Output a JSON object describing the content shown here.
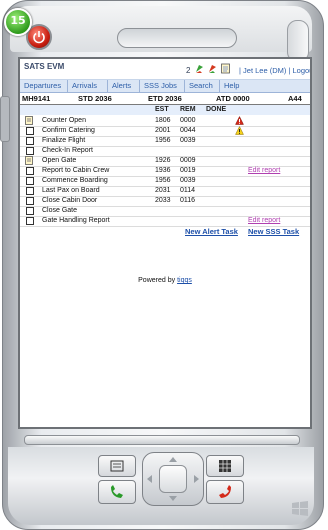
{
  "device": {
    "badge_text": "15"
  },
  "titlebar": {
    "app_title": "SATS EVM",
    "alert_count": "2",
    "user_text": "| Jet Lee (DM) | Logout"
  },
  "tabs": [
    "Departures",
    "Arrivals",
    "Alerts",
    "SSS Jobs",
    "Search",
    "Help"
  ],
  "flight": {
    "number": "MH9141",
    "std": "STD 2036",
    "etd": "ETD 2036",
    "atd": "ATD 0000",
    "gate": "A44"
  },
  "columns": {
    "est": "EST",
    "rem": "REM",
    "done": "DONE"
  },
  "tasks": [
    {
      "name": "Counter Open",
      "est": "1806",
      "rem": "0000",
      "icon": "note-icon",
      "alert": "red-alert-icon",
      "edit": ""
    },
    {
      "name": "Confirm Catering",
      "est": "2001",
      "rem": "0044",
      "icon": "checkbox",
      "alert": "yellow-warning-icon",
      "edit": ""
    },
    {
      "name": "Finalize Flight",
      "est": "1956",
      "rem": "0039",
      "icon": "checkbox",
      "alert": "",
      "edit": ""
    },
    {
      "name": "Check-In Report",
      "est": "",
      "rem": "",
      "icon": "checkbox",
      "alert": "",
      "edit": ""
    },
    {
      "name": "Open Gate",
      "est": "1926",
      "rem": "0009",
      "icon": "note-icon",
      "alert": "",
      "edit": ""
    },
    {
      "name": "Report to Cabin Crew",
      "est": "1936",
      "rem": "0019",
      "icon": "checkbox",
      "alert": "",
      "edit": "Edit report"
    },
    {
      "name": "Commence Boarding",
      "est": "1956",
      "rem": "0039",
      "icon": "checkbox",
      "alert": "",
      "edit": ""
    },
    {
      "name": "Last Pax on Board",
      "est": "2031",
      "rem": "0114",
      "icon": "checkbox",
      "alert": "",
      "edit": ""
    },
    {
      "name": "Close Cabin Door",
      "est": "2033",
      "rem": "0116",
      "icon": "checkbox",
      "alert": "",
      "edit": ""
    },
    {
      "name": "Close Gate",
      "est": "",
      "rem": "",
      "icon": "checkbox",
      "alert": "",
      "edit": ""
    },
    {
      "name": "Gate Handling Report",
      "est": "",
      "rem": "",
      "icon": "checkbox",
      "alert": "",
      "edit": "Edit report"
    }
  ],
  "links": {
    "new_alert": "New Alert Task",
    "new_sss": "New SSS Task"
  },
  "footer": {
    "powered_by": "Powered by ",
    "powered_link": "tiqqs"
  }
}
